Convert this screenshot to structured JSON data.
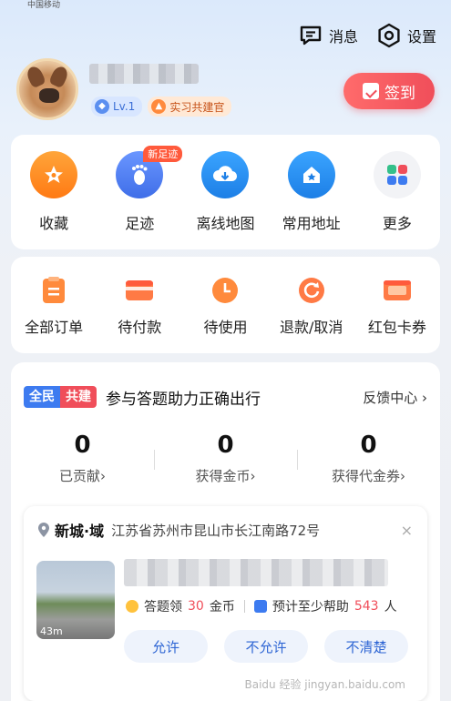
{
  "status_bar": {
    "carrier": "中国移动",
    "time": ""
  },
  "top_actions": {
    "messages": "消息",
    "settings": "设置"
  },
  "profile": {
    "level": "Lv.1",
    "title_badge": "实习共建官"
  },
  "checkin": {
    "label": "签到"
  },
  "quick_links": [
    {
      "label": "收藏",
      "icon": "star-icon",
      "color": "#ff8a1f"
    },
    {
      "label": "足迹",
      "icon": "footprint-icon",
      "color": "#4f7df3",
      "tag": "新足迹"
    },
    {
      "label": "离线地图",
      "icon": "cloud-download-icon",
      "color": "#2c8ef0"
    },
    {
      "label": "常用地址",
      "icon": "home-icon",
      "color": "#2c8ef0"
    },
    {
      "label": "更多",
      "icon": "grid-icon",
      "color": "#f2f3f6"
    }
  ],
  "orders": [
    {
      "label": "全部订单",
      "icon": "order-icon"
    },
    {
      "label": "待付款",
      "icon": "wallet-icon"
    },
    {
      "label": "待使用",
      "icon": "clock-icon"
    },
    {
      "label": "退款/取消",
      "icon": "refund-icon"
    },
    {
      "label": "红包卡券",
      "icon": "coupon-icon"
    }
  ],
  "contrib": {
    "tag_a": "全民",
    "tag_b": "共建",
    "title": "参与答题助力正确出行",
    "feedback": "反馈中心 ›",
    "stats": [
      {
        "value": "0",
        "label": "已贡献›"
      },
      {
        "value": "0",
        "label": "获得金币›"
      },
      {
        "value": "0",
        "label": "获得代金券›"
      }
    ]
  },
  "task": {
    "place": "新城·域",
    "address": "江苏省苏州市昆山市长江南路72号",
    "close": "×",
    "distance": "43m",
    "reward_prefix": "答题领",
    "reward_amount": "30",
    "reward_suffix": "金币",
    "help_prefix": "预计至少帮助",
    "help_amount": "543",
    "help_suffix": "人",
    "buttons": [
      "允许",
      "不允许",
      "不清楚"
    ]
  },
  "watermark": "Baidu 经验 jingyan.baidu.com"
}
